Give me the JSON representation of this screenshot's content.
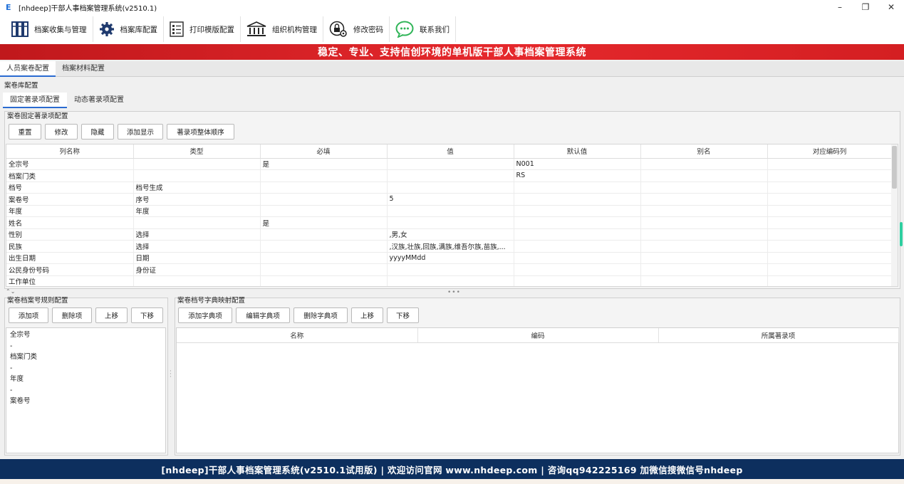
{
  "window": {
    "app_icon": "E",
    "title": "[nhdeep]干部人事档案管理系统(v2510.1)",
    "minimize": "–",
    "maximize": "❐",
    "close": "✕"
  },
  "toolbar": {
    "items": [
      {
        "label": "档案收集与管理",
        "icon": "archive-shelf-icon"
      },
      {
        "label": "档案库配置",
        "icon": "gear-icon"
      },
      {
        "label": "打印模版配置",
        "icon": "print-template-icon"
      },
      {
        "label": "组织机构管理",
        "icon": "institution-building-icon"
      },
      {
        "label": "修改密码",
        "icon": "lock-gear-icon"
      },
      {
        "label": "联系我们",
        "icon": "chat-bubble-icon"
      }
    ]
  },
  "banner": {
    "text": "稳定、专业、支持信创环境的单机版干部人事档案管理系统"
  },
  "main_tabs": [
    {
      "label": "人员案卷配置",
      "active": true
    },
    {
      "label": "档案材料配置",
      "active": false
    }
  ],
  "library_config_label": "案卷库配置",
  "sub_tabs": [
    {
      "label": "固定著录项配置",
      "active": true
    },
    {
      "label": "动态著录项配置",
      "active": false
    }
  ],
  "fixed_section": {
    "title": "案卷固定著录项配置",
    "buttons": [
      "重置",
      "修改",
      "隐藏",
      "添加显示",
      "著录项整体顺序"
    ],
    "columns": [
      "列名称",
      "类型",
      "必填",
      "值",
      "默认值",
      "别名",
      "对应编码列"
    ],
    "rows": [
      [
        "全宗号",
        "",
        "是",
        "",
        "N001",
        "",
        ""
      ],
      [
        "档案门类",
        "",
        "",
        "",
        "RS",
        "",
        ""
      ],
      [
        "档号",
        "档号生成",
        "",
        "",
        "",
        "",
        ""
      ],
      [
        "案卷号",
        "序号",
        "",
        "5",
        "",
        "",
        ""
      ],
      [
        "年度",
        "年度",
        "",
        "",
        "",
        "",
        ""
      ],
      [
        "姓名",
        "",
        "是",
        "",
        "",
        "",
        ""
      ],
      [
        "性别",
        "选择",
        "",
        ",男,女",
        "",
        "",
        ""
      ],
      [
        "民族",
        "选择",
        "",
        ",汉族,壮族,回族,满族,维吾尔族,苗族,...",
        "",
        "",
        ""
      ],
      [
        "出生日期",
        "日期",
        "",
        "yyyyMMdd",
        "",
        "",
        ""
      ],
      [
        "公民身份号码",
        "身份证",
        "",
        "",
        "",
        "",
        ""
      ],
      [
        "工作单位",
        "",
        "",
        "",
        "",
        "",
        ""
      ]
    ]
  },
  "rule_section": {
    "title": "案卷档案号规则配置",
    "buttons": [
      "添加项",
      "删除项",
      "上移",
      "下移"
    ],
    "items": [
      "全宗号",
      "-",
      "档案门类",
      "-",
      "年度",
      "-",
      "案卷号"
    ]
  },
  "dict_section": {
    "title": "案卷档号字典映射配置",
    "buttons": [
      "添加字典项",
      "编辑字典项",
      "删除字典项",
      "上移",
      "下移"
    ],
    "columns": [
      "名称",
      "编码",
      "所属著录项"
    ]
  },
  "footer": {
    "text": "[nhdeep]干部人事档案管理系统(v2510.1试用版) | 欢迎访问官网 www.nhdeep.com | 咨询qq942225169 加微信搜微信号nhdeep"
  },
  "colors": {
    "banner_red": "#d41f22",
    "footer_navy": "#0d2f5e",
    "tab_accent": "#2a6bd1",
    "icon_navy": "#1f3a6e"
  }
}
